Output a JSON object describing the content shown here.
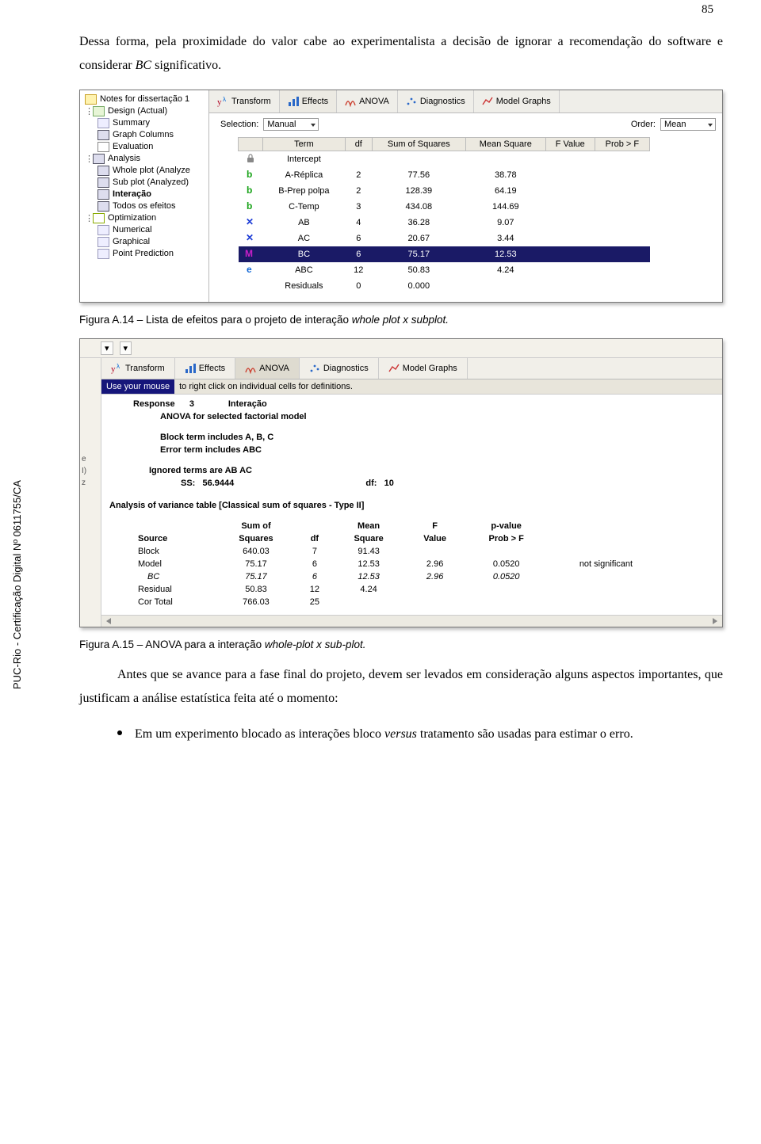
{
  "page_number": "85",
  "side_text": "PUC-Rio - Certificação Digital Nº 0611755/CA",
  "para1_a": "Dessa forma, pela proximidade do valor cabe ao experimentalista a decisão de ignorar a recomendação do software e considerar ",
  "para1_b": "BC",
  "para1_c": " significativo.",
  "caption1_a": "Figura A.14 – Lista de efeitos para o projeto de interação ",
  "caption1_b": "whole plot x subplot.",
  "caption2_a": "Figura A.15 – ANOVA para a interação ",
  "caption2_b": "whole-plot x sub-plot.",
  "para2": "Antes que se avance para a fase final do projeto, devem ser levados em consideração alguns aspectos importantes, que justificam a análise estatística feita até o momento:",
  "bullet1_a": "Em um experimento blocado as interações bloco ",
  "bullet1_b": "versus",
  "bullet1_c": " tratamento são usadas para estimar o erro.",
  "shot1": {
    "tree": {
      "root": "Notes for dissertação 1",
      "design": "Design (Actual)",
      "summary": "Summary",
      "graphcols": "Graph Columns",
      "evaluation": "Evaluation",
      "analysis": "Analysis",
      "whole": "Whole plot (Analyze",
      "sub": "Sub plot (Analyzed)",
      "inter": "Interação",
      "todos": "Todos os efeitos",
      "opt": "Optimization",
      "num": "Numerical",
      "graph": "Graphical",
      "point": "Point Prediction"
    },
    "tabs": {
      "transform": "Transform",
      "effects": "Effects",
      "anova": "ANOVA",
      "diag": "Diagnostics",
      "model": "Model Graphs"
    },
    "sel_label": "Selection:",
    "sel_value": "Manual",
    "order_label": "Order:",
    "order_value": "Mean",
    "headers": {
      "term": "Term",
      "df": "df",
      "ss": "Sum of Squares",
      "ms": "Mean Square",
      "f": "F Value",
      "p": "Prob > F"
    },
    "rows": [
      {
        "icon": "lock",
        "term": "Intercept",
        "df": "",
        "ss": "",
        "ms": "",
        "f": "",
        "p": ""
      },
      {
        "icon": "b-green",
        "term": "A-Réplica",
        "df": "2",
        "ss": "77.56",
        "ms": "38.78",
        "f": "",
        "p": ""
      },
      {
        "icon": "b-green",
        "term": "B-Prep polpa",
        "df": "2",
        "ss": "128.39",
        "ms": "64.19",
        "f": "",
        "p": ""
      },
      {
        "icon": "b-green",
        "term": "C-Temp",
        "df": "3",
        "ss": "434.08",
        "ms": "144.69",
        "f": "",
        "p": ""
      },
      {
        "icon": "x-blue",
        "term": "AB",
        "df": "4",
        "ss": "36.28",
        "ms": "9.07",
        "f": "",
        "p": ""
      },
      {
        "icon": "x-blue",
        "term": "AC",
        "df": "6",
        "ss": "20.67",
        "ms": "3.44",
        "f": "",
        "p": ""
      },
      {
        "icon": "m-mag",
        "term": "BC",
        "df": "6",
        "ss": "75.17",
        "ms": "12.53",
        "f": "",
        "p": "",
        "selected": true
      },
      {
        "icon": "e-blue",
        "term": "ABC",
        "df": "12",
        "ss": "50.83",
        "ms": "4.24",
        "f": "",
        "p": ""
      },
      {
        "icon": "",
        "term": "Residuals",
        "df": "0",
        "ss": "0.000",
        "ms": "",
        "f": "",
        "p": ""
      }
    ]
  },
  "shot2": {
    "tabs": {
      "transform": "Transform",
      "effects": "Effects",
      "anova": "ANOVA",
      "diag": "Diagnostics",
      "model": "Model Graphs"
    },
    "hint_blue": "Use your mouse",
    "hint_rest": " to right click on individual cells for definitions.",
    "resp_lbl": "Response",
    "resp_num": "3",
    "resp_name": "Interação",
    "anova_title": "ANOVA for selected factorial model",
    "block_includes": "Block term includes A, B, C",
    "error_includes": "Error term includes ABC",
    "ignored": "Ignored terms are AB AC",
    "ss_lbl": "SS:",
    "ss_val": "56.9444",
    "df_lbl": "df:",
    "df_val": "10",
    "tbl_title": "Analysis of variance table [Classical sum of squares - Type II]",
    "hdr": {
      "source": "Source",
      "sumof": "Sum of",
      "squares": "Squares",
      "df": "df",
      "mean": "Mean",
      "square": "Square",
      "f": "F",
      "value": "Value",
      "pval": "p-value",
      "probf": "Prob > F"
    },
    "rows": [
      {
        "src": "Block",
        "ss": "640.03",
        "df": "7",
        "ms": "91.43",
        "f": "",
        "p": "",
        "note": ""
      },
      {
        "src": "Model",
        "ss": "75.17",
        "df": "6",
        "ms": "12.53",
        "f": "2.96",
        "p": "0.0520",
        "note": "not significant"
      },
      {
        "src": "BC",
        "ss": "75.17",
        "df": "6",
        "ms": "12.53",
        "f": "2.96",
        "p": "0.0520",
        "note": "",
        "italic": true
      },
      {
        "src": "Residual",
        "ss": "50.83",
        "df": "12",
        "ms": "4.24",
        "f": "",
        "p": "",
        "note": ""
      },
      {
        "src": "Cor Total",
        "ss": "766.03",
        "df": "25",
        "ms": "",
        "f": "",
        "p": "",
        "note": ""
      }
    ]
  }
}
